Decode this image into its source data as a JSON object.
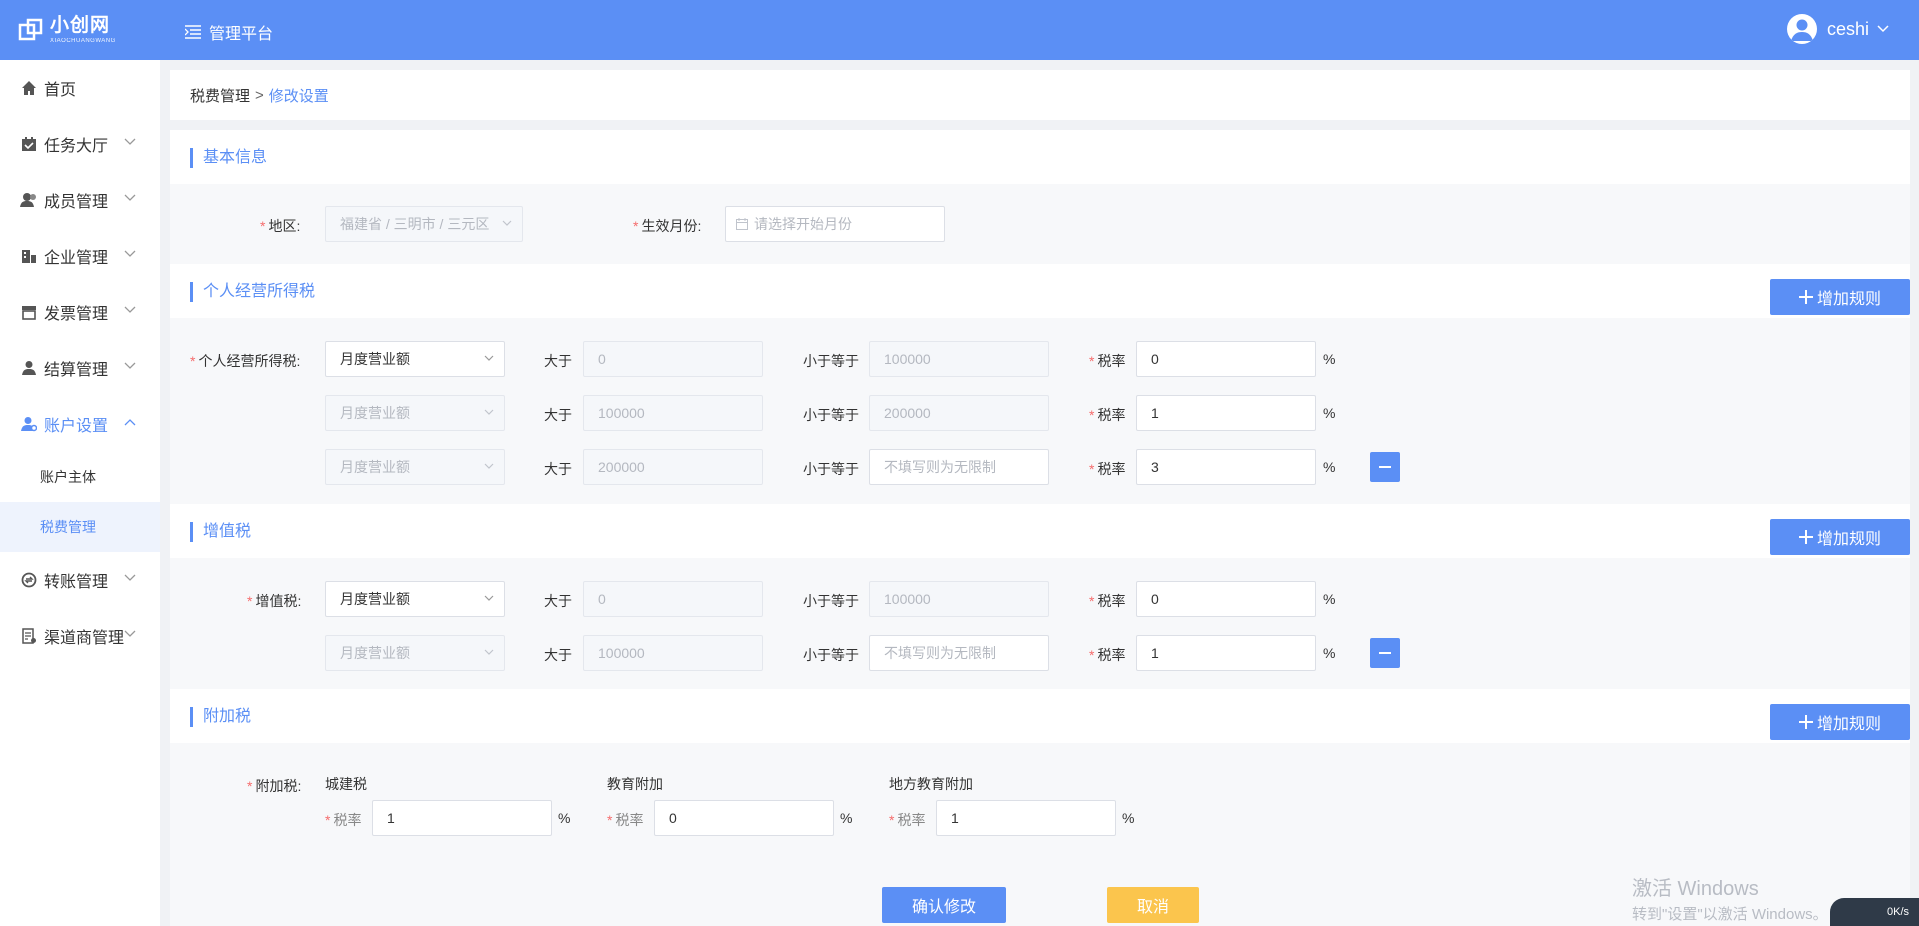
{
  "app": {
    "logo_title": "小创网",
    "logo_sub": "XIAOCHUANGWANG",
    "platform": "管理平台",
    "username": "ceshi"
  },
  "sidebar": {
    "items": [
      {
        "label": "首页"
      },
      {
        "label": "任务大厅"
      },
      {
        "label": "成员管理"
      },
      {
        "label": "企业管理"
      },
      {
        "label": "发票管理"
      },
      {
        "label": "结算管理"
      },
      {
        "label": "账户设置"
      },
      {
        "label": "转账管理"
      },
      {
        "label": "渠道商管理"
      }
    ],
    "sub_items": [
      {
        "label": "账户主体"
      },
      {
        "label": "税费管理"
      }
    ]
  },
  "breadcrumb": {
    "parent": "税费管理",
    "sep": ">",
    "current": "修改设置"
  },
  "basic": {
    "title": "基本信息",
    "region_label": "地区:",
    "region_value": "福建省 / 三明市 / 三元区",
    "month_label": "生效月份:",
    "month_placeholder": "请选择开始月份"
  },
  "personal": {
    "title": "个人经营所得税",
    "add_label": "增加规则",
    "field_label": "个人经营所得税:",
    "rows": [
      {
        "type": "月度营业额",
        "gt": "0",
        "lte": "100000",
        "rate": "0"
      },
      {
        "type": "月度营业额",
        "gt": "100000",
        "lte": "200000",
        "rate": "1"
      },
      {
        "type": "月度营业额",
        "gt": "200000",
        "lte": "",
        "lte_placeholder": "不填写则为无限制",
        "rate": "3"
      }
    ]
  },
  "vat": {
    "title": "增值税",
    "add_label": "增加规则",
    "field_label": "增值税:",
    "rows": [
      {
        "type": "月度营业额",
        "gt": "0",
        "lte": "100000",
        "rate": "0"
      },
      {
        "type": "月度营业额",
        "gt": "100000",
        "lte": "",
        "lte_placeholder": "不填写则为无限制",
        "rate": "1"
      }
    ]
  },
  "surtax": {
    "title": "附加税",
    "add_label": "增加规则",
    "field_label": "附加税:",
    "items": [
      {
        "name": "城建税",
        "rate_label": "税率",
        "rate": "1"
      },
      {
        "name": "教育附加",
        "rate_label": "税率",
        "rate": "0"
      },
      {
        "name": "地方教育附加",
        "rate_label": "税率",
        "rate": "1"
      }
    ]
  },
  "common": {
    "gt_label": "大于",
    "lte_label": "小于等于",
    "rate_label": "税率",
    "percent": "%"
  },
  "actions": {
    "confirm": "确认修改",
    "cancel": "取消"
  },
  "watermark": {
    "line1": "激活 Windows",
    "line2": "转到\"设置\"以激活 Windows。"
  },
  "speed": "0K/s",
  "colors": {
    "primary": "#5b8ff5",
    "cancel": "#fbc54d",
    "required": "#f56c6c"
  }
}
